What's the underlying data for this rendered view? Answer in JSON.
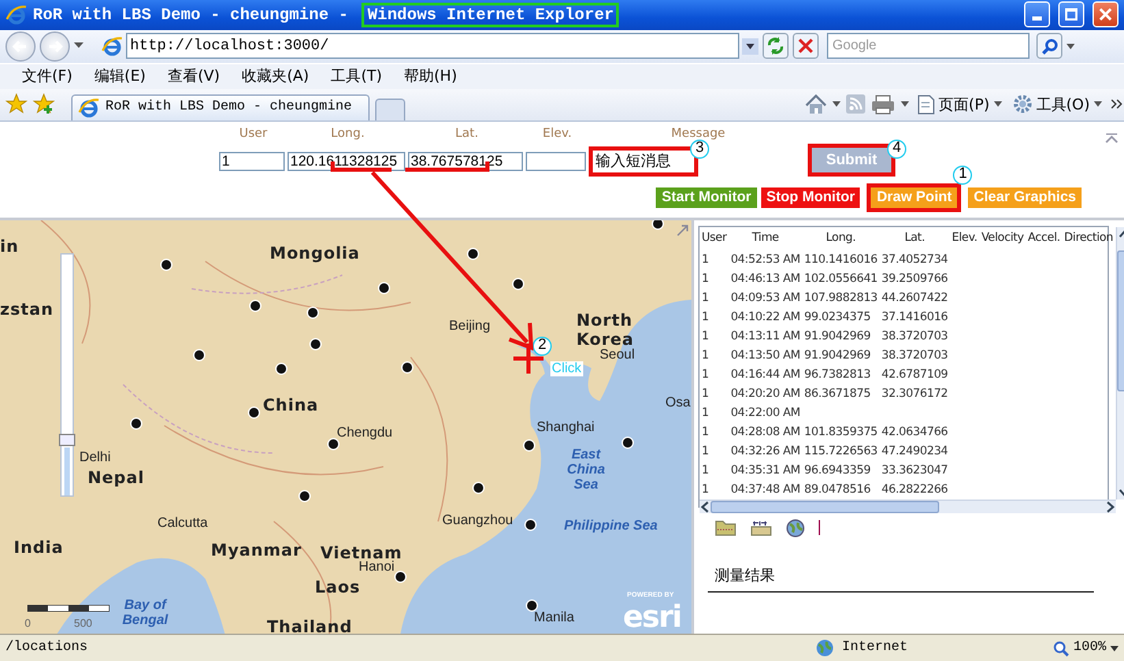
{
  "window": {
    "title": "RoR with LBS Demo - cheungmine -",
    "title_app": "Windows Internet Explorer"
  },
  "address_bar": {
    "url": "http://localhost:3000/",
    "search_placeholder": "Google"
  },
  "menu": [
    "文件(F)",
    "编辑(E)",
    "查看(V)",
    "收藏夹(A)",
    "工具(T)",
    "帮助(H)"
  ],
  "tabs": [
    {
      "label": "RoR with LBS Demo - cheungmine",
      "selected": true
    }
  ],
  "command_bar": [
    {
      "label": "页面(P)",
      "kind": "page"
    },
    {
      "label": "工具(O)",
      "kind": "tools"
    }
  ],
  "form": {
    "fields": [
      {
        "label": "User",
        "value": "1",
        "annotated": false
      },
      {
        "label": "Long.",
        "value": "120.1611328125",
        "annotated": false
      },
      {
        "label": "Lat.",
        "value": "38.767578125",
        "annotated": false
      },
      {
        "label": "Elev.",
        "annotated": false
      },
      {
        "label": "Message",
        "value": "输入短消息",
        "annotated": true,
        "marker": "3"
      }
    ],
    "submit": {
      "label": "Submit",
      "annotated": true,
      "marker": "4"
    }
  },
  "actions": [
    {
      "label": "Start Monitor",
      "color": "#5ba11c",
      "annotated": false
    },
    {
      "label": "Stop Monitor",
      "color": "#ee1111",
      "annotated": false
    },
    {
      "label": "Draw Point",
      "color": "#f5a01a",
      "annotated": true,
      "marker": "1"
    },
    {
      "label": "Clear Graphics",
      "color": "#f5a01a",
      "annotated": false
    }
  ],
  "map": {
    "zoom": {
      "level": 0.2
    },
    "labels": [
      {
        "text": "in",
        "kind": "country"
      },
      {
        "text": "Mongolia",
        "kind": "country"
      },
      {
        "text": "zstan",
        "kind": "country"
      },
      {
        "text": "Beijing",
        "kind": "city"
      },
      {
        "text": "North Korea",
        "kind": "country"
      },
      {
        "text": "Seoul",
        "kind": "city"
      },
      {
        "text": "China",
        "kind": "country"
      },
      {
        "text": "Osa",
        "kind": "city"
      },
      {
        "text": "Chengdu",
        "kind": "city"
      },
      {
        "text": "Shanghai",
        "kind": "city"
      },
      {
        "text": "Delhi",
        "kind": "city"
      },
      {
        "text": "Nepal",
        "kind": "country"
      },
      {
        "text": "East China Sea",
        "kind": "sea"
      },
      {
        "text": "Calcutta",
        "kind": "city"
      },
      {
        "text": "Guangzhou",
        "kind": "city"
      },
      {
        "text": "Philippine Sea",
        "kind": "sea"
      },
      {
        "text": "India",
        "kind": "country"
      },
      {
        "text": "Myanmar",
        "kind": "country"
      },
      {
        "text": "Vietnam",
        "kind": "country"
      },
      {
        "text": "Hanoi",
        "kind": "city"
      },
      {
        "text": "Laos",
        "kind": "country"
      },
      {
        "text": "Bay of Bengal",
        "kind": "sea"
      },
      {
        "text": "Thailand",
        "kind": "country"
      },
      {
        "text": "Manila",
        "kind": "city"
      }
    ],
    "click": {
      "label": "Click",
      "marker": "2"
    },
    "scale": [
      "0",
      "500"
    ],
    "attribution": {
      "caption": "POWERED BY",
      "logo": "esri"
    }
  },
  "table": {
    "columns": [
      "User",
      "Time",
      "Long.",
      "Lat.",
      "Elev.",
      "Velocity",
      "Accel.",
      "Direction"
    ],
    "rows": [
      [
        "1",
        "04:52:53 AM",
        "110.1416016",
        "37.4052734"
      ],
      [
        "1",
        "04:46:13 AM",
        "102.0556641",
        "39.2509766"
      ],
      [
        "1",
        "04:09:53 AM",
        "107.9882813",
        "44.2607422"
      ],
      [
        "1",
        "04:10:22 AM",
        "99.0234375",
        "37.1416016"
      ],
      [
        "1",
        "04:13:11 AM",
        "91.9042969",
        "38.3720703"
      ],
      [
        "1",
        "04:13:50 AM",
        "91.9042969",
        "38.3720703"
      ],
      [
        "1",
        "04:16:44 AM",
        "96.7382813",
        "42.6787109"
      ],
      [
        "1",
        "04:20:20 AM",
        "86.3671875",
        "32.3076172"
      ],
      [
        "1",
        "04:22:00 AM"
      ],
      [
        "1",
        "04:28:08 AM",
        "101.8359375",
        "42.0634766"
      ],
      [
        "1",
        "04:32:26 AM",
        "115.7226563",
        "47.2490234"
      ],
      [
        "1",
        "04:35:31 AM",
        "96.6943359",
        "33.3623047"
      ],
      [
        "1",
        "04:37:48 AM",
        "89.0478516",
        "46.2822266"
      ]
    ]
  },
  "measure": {
    "title": "测量结果"
  },
  "status_bar": {
    "url": "/locations",
    "zone": "Internet",
    "zoom": "100%"
  }
}
